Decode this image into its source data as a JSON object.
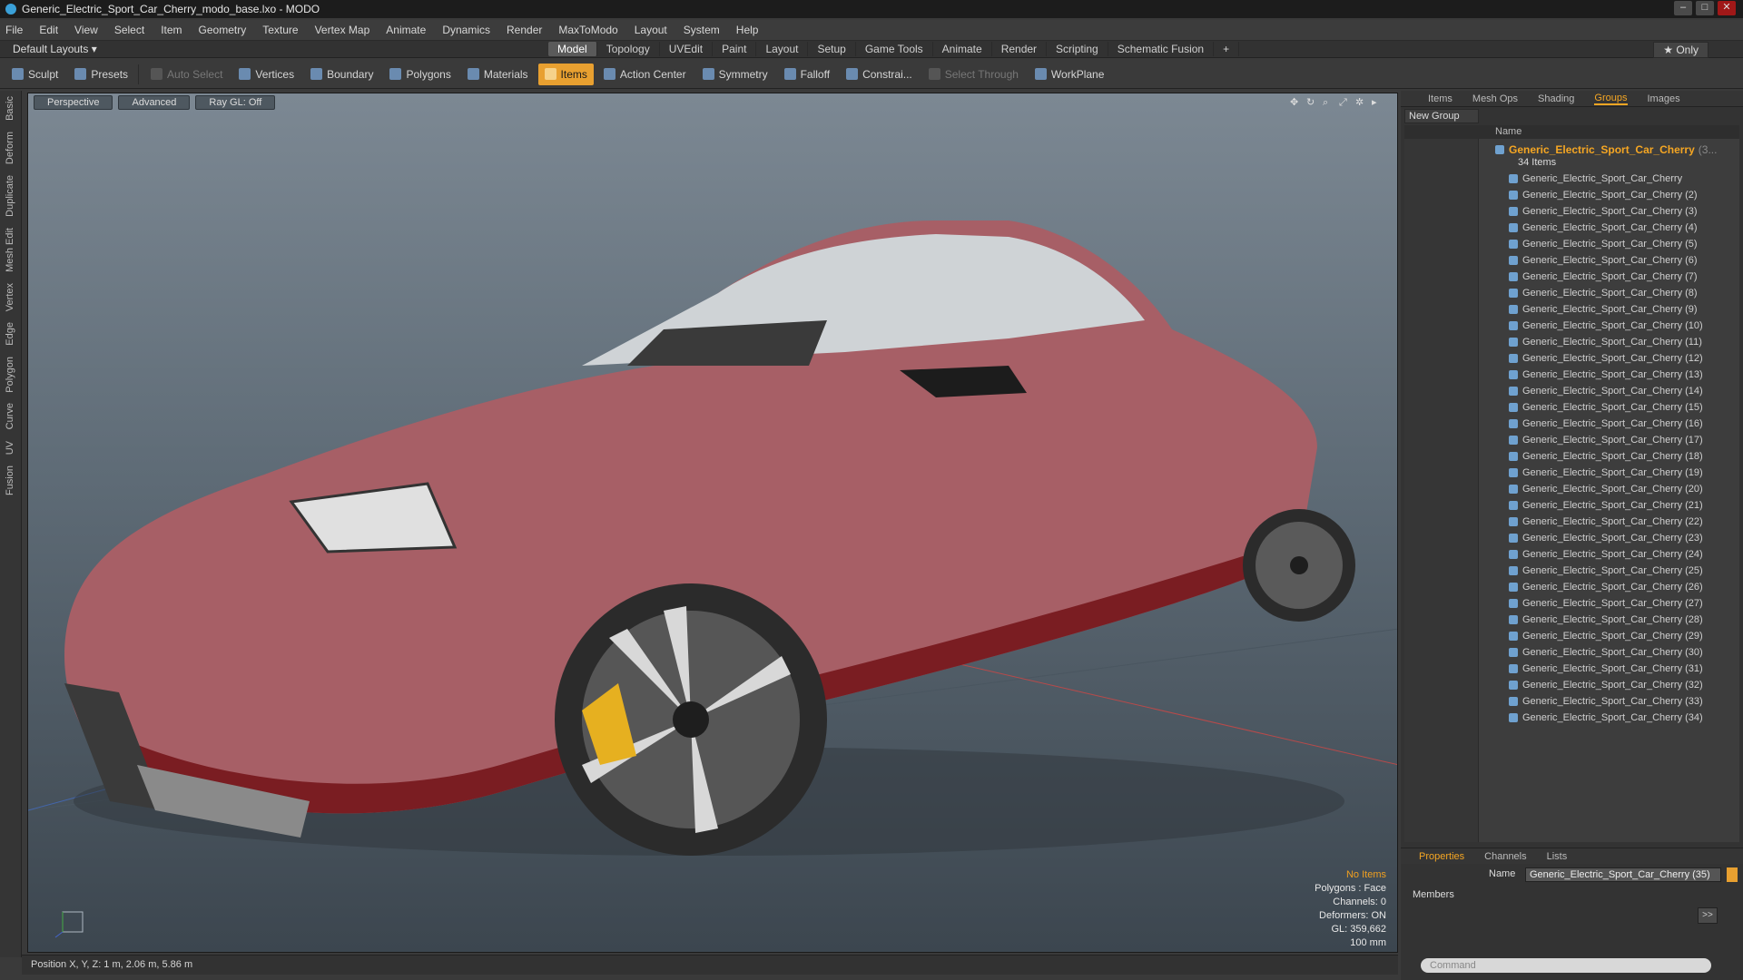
{
  "window": {
    "title": "Generic_Electric_Sport_Car_Cherry_modo_base.lxo - MODO"
  },
  "menu": [
    "File",
    "Edit",
    "View",
    "Select",
    "Item",
    "Geometry",
    "Texture",
    "Vertex Map",
    "Animate",
    "Dynamics",
    "Render",
    "MaxToModo",
    "Layout",
    "System",
    "Help"
  ],
  "layout": {
    "default": "Default Layouts ▾",
    "tabs": [
      "Model",
      "Topology",
      "UVEdit",
      "Paint",
      "Layout",
      "Setup",
      "Game Tools",
      "Animate",
      "Render",
      "Scripting",
      "Schematic Fusion"
    ],
    "only": "★ Only"
  },
  "toolbar": [
    "Sculpt",
    "Presets",
    "Auto Select",
    "Vertices",
    "Boundary",
    "Polygons",
    "Materials",
    "Items",
    "Action Center",
    "Symmetry",
    "Falloff",
    "Constrai...",
    "Select Through",
    "WorkPlane"
  ],
  "side_tabs": [
    "Basic",
    "Deform",
    "Duplicate",
    "Mesh Edit",
    "Vertex",
    "Edge",
    "Polygon",
    "Curve",
    "UV",
    "Fusion"
  ],
  "viewport": {
    "buttons": [
      "Perspective",
      "Advanced",
      "Ray GL: Off"
    ],
    "stats": {
      "items": "No Items",
      "polygons": "Polygons : Face",
      "channels": "Channels: 0",
      "deformers": "Deformers: ON",
      "gl": "GL: 359,662",
      "scale": "100 mm"
    }
  },
  "status": "Position X, Y, Z:  1 m, 2.06 m, 5.86 m",
  "right_panel": {
    "tabs": [
      "Items",
      "Mesh Ops",
      "Shading",
      "Groups",
      "Images"
    ],
    "new_group": "New Group",
    "name_header": "Name",
    "group": "Generic_Electric_Sport_Car_Cherry",
    "group_suffix": "(3...",
    "count": "34 Items",
    "items": [
      "Generic_Electric_Sport_Car_Cherry",
      "Generic_Electric_Sport_Car_Cherry (2)",
      "Generic_Electric_Sport_Car_Cherry (3)",
      "Generic_Electric_Sport_Car_Cherry (4)",
      "Generic_Electric_Sport_Car_Cherry (5)",
      "Generic_Electric_Sport_Car_Cherry (6)",
      "Generic_Electric_Sport_Car_Cherry (7)",
      "Generic_Electric_Sport_Car_Cherry (8)",
      "Generic_Electric_Sport_Car_Cherry (9)",
      "Generic_Electric_Sport_Car_Cherry (10)",
      "Generic_Electric_Sport_Car_Cherry (11)",
      "Generic_Electric_Sport_Car_Cherry (12)",
      "Generic_Electric_Sport_Car_Cherry (13)",
      "Generic_Electric_Sport_Car_Cherry (14)",
      "Generic_Electric_Sport_Car_Cherry (15)",
      "Generic_Electric_Sport_Car_Cherry (16)",
      "Generic_Electric_Sport_Car_Cherry (17)",
      "Generic_Electric_Sport_Car_Cherry (18)",
      "Generic_Electric_Sport_Car_Cherry (19)",
      "Generic_Electric_Sport_Car_Cherry (20)",
      "Generic_Electric_Sport_Car_Cherry (21)",
      "Generic_Electric_Sport_Car_Cherry (22)",
      "Generic_Electric_Sport_Car_Cherry (23)",
      "Generic_Electric_Sport_Car_Cherry (24)",
      "Generic_Electric_Sport_Car_Cherry (25)",
      "Generic_Electric_Sport_Car_Cherry (26)",
      "Generic_Electric_Sport_Car_Cherry (27)",
      "Generic_Electric_Sport_Car_Cherry (28)",
      "Generic_Electric_Sport_Car_Cherry (29)",
      "Generic_Electric_Sport_Car_Cherry (30)",
      "Generic_Electric_Sport_Car_Cherry (31)",
      "Generic_Electric_Sport_Car_Cherry (32)",
      "Generic_Electric_Sport_Car_Cherry (33)",
      "Generic_Electric_Sport_Car_Cherry (34)"
    ]
  },
  "properties": {
    "tabs": [
      "Properties",
      "Channels",
      "Lists"
    ],
    "name_label": "Name",
    "name_value": "Generic_Electric_Sport_Car_Cherry (35)",
    "members": "Members",
    "command_placeholder": "Command"
  }
}
